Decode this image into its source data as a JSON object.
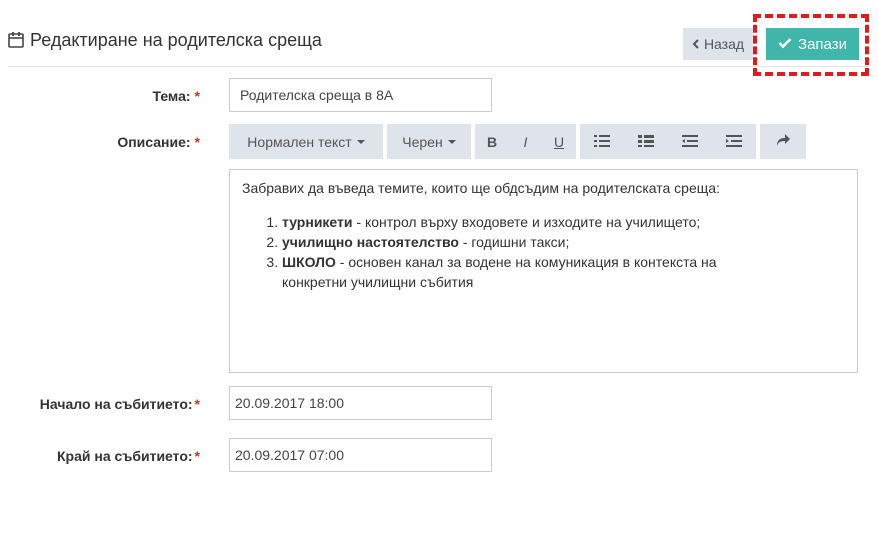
{
  "header": {
    "title": "Редактиране на родителска среща",
    "icon": "calendar-icon"
  },
  "actions": {
    "back_label": "Назад",
    "save_label": "Запази"
  },
  "form": {
    "topic": {
      "label": "Тема:",
      "required": "*",
      "value": "Родителска среща в 8А"
    },
    "description": {
      "label": "Описание:",
      "required": "*",
      "toolbar": {
        "format": "Нормален текст",
        "color": "Черен",
        "bold": "B",
        "italic": "I",
        "underline": "U"
      },
      "intro": "Забравих да въведа темите, които ще обдсъдим на родителската среща:",
      "items": [
        {
          "bold": "турникети",
          "rest": " - контрол върху входовете и изходите на училището;"
        },
        {
          "bold": "училищно настоятелство",
          "rest": " - годишни такси;"
        },
        {
          "bold": "ШКОЛО",
          "rest": " - основен канал за водене на комуникация в контекста на конкретни училищни събития"
        }
      ]
    },
    "start": {
      "label": "Начало на събитието:",
      "required": "*",
      "value": "20.09.2017 18:00"
    },
    "end": {
      "label": "Край на събитието:",
      "required": "*",
      "value": "20.09.2017 07:00"
    }
  },
  "colors": {
    "save": "#3fb6a8",
    "highlight": "#e01b1b",
    "toolbar": "#dfe3ea"
  }
}
